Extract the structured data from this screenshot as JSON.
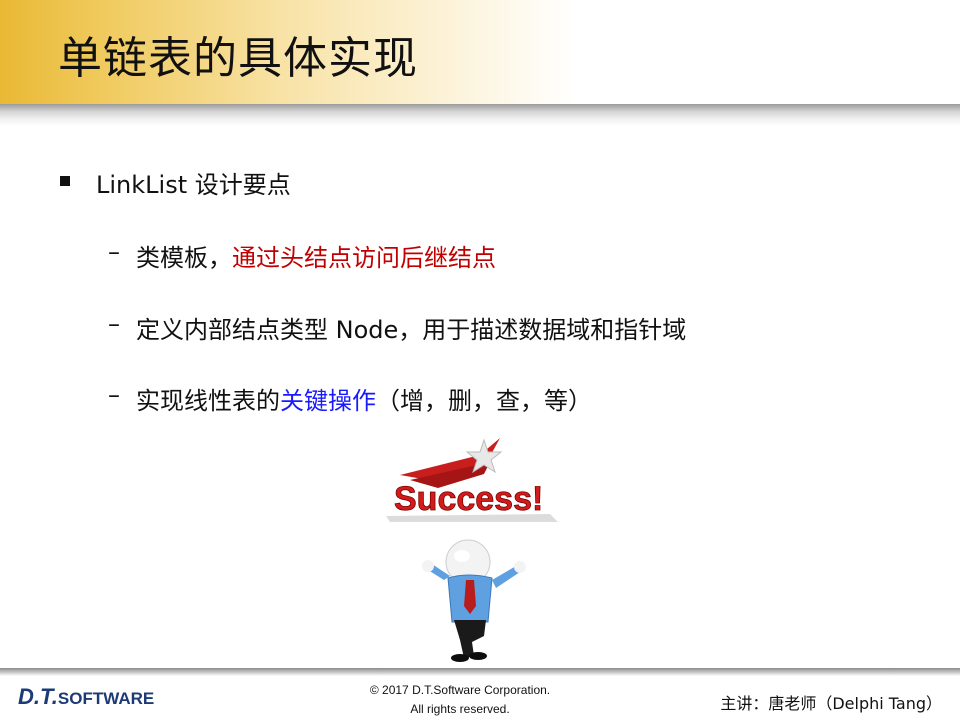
{
  "title": "单链表的具体实现",
  "bullet": {
    "main": "LinkList 设计要点"
  },
  "sub_points": [
    {
      "parts": [
        {
          "text": "类模板，",
          "color": "black"
        },
        {
          "text": "通过头结点访问后继结点",
          "color": "red"
        }
      ]
    },
    {
      "parts": [
        {
          "text": "定义内部结点类型 Node，用于描述数据域和指针域",
          "color": "black"
        }
      ]
    },
    {
      "parts": [
        {
          "text": "实现线性表的",
          "color": "black"
        },
        {
          "text": "关键操作",
          "color": "blue"
        },
        {
          "text": "（增，删，查，等）",
          "color": "black"
        }
      ]
    }
  ],
  "dash_symbol": "–",
  "illustration": {
    "label": "Success!",
    "icon": "success-figure-icon"
  },
  "footer": {
    "logo_prefix": "D.T.",
    "logo_suffix": "SOFTWARE",
    "copyright_line1": "© 2017 D.T.Software Corporation.",
    "copyright_line2": "All rights reserved.",
    "presenter": "主讲：唐老师（Delphi Tang）"
  },
  "colors": {
    "red": "#c00000",
    "blue": "#1a1aff",
    "title_band": "#e9b934"
  }
}
